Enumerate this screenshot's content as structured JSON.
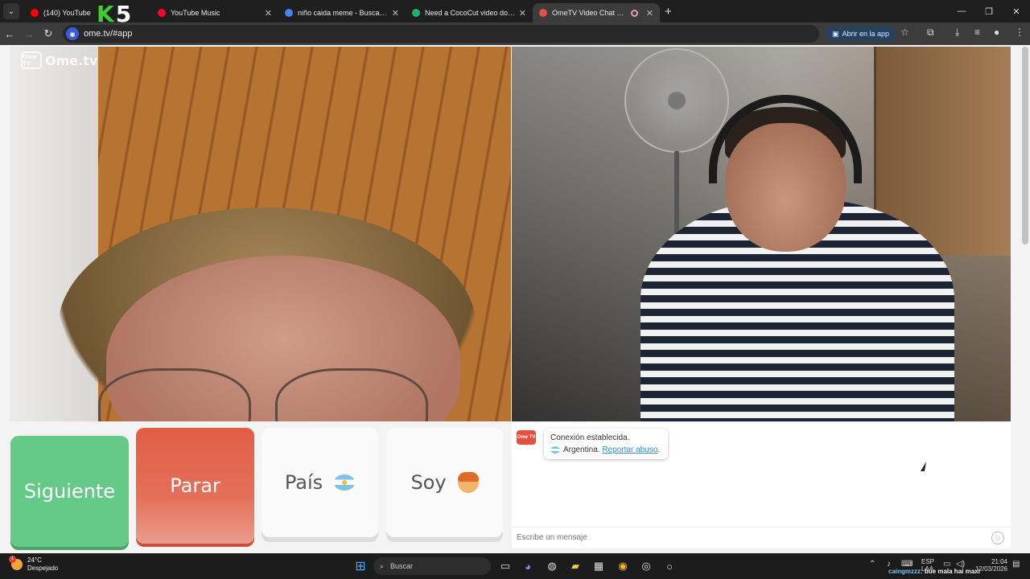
{
  "browser": {
    "tabs": [
      {
        "title": "(140) YouTube",
        "fav_color": "#ff0000",
        "active": false
      },
      {
        "title": "YouTube Music",
        "fav_color": "#ff0033",
        "active": false
      },
      {
        "title": "niño caida meme - Buscar con",
        "fav_color": "#4285f4",
        "active": false
      },
      {
        "title": "Need a CocoCut video downlo",
        "fav_color": "#1db36b",
        "active": false
      },
      {
        "title": "OmeTV Video Chat — Ome",
        "fav_color": "#e44f3f",
        "active": true
      }
    ],
    "overlay_logo": {
      "k": "K",
      "n": "5"
    },
    "url": "ome.tv/#app",
    "open_app_label": "Abrir en la app"
  },
  "site": {
    "logo_text": "Ome.tv",
    "logo_box": "Ome TV",
    "buttons": {
      "next": "Siguiente",
      "stop": "Parar",
      "country": "País",
      "iam": "Soy"
    },
    "chat": {
      "logo": "Ome TV",
      "connected": "Conexión establecida.",
      "country": "Argentina.",
      "report": "Reportar abuso",
      "report_suffix": ".",
      "input_placeholder": "Escribe un mensaje"
    }
  },
  "taskbar": {
    "weather_temp": "24°C",
    "weather_desc": "Despejado",
    "weather_badge": "1",
    "search_label": "Buscar",
    "lang": "ESP",
    "lang_sub": "LAA",
    "time": "21:04",
    "date": "12/03/2026"
  },
  "stream_chat": {
    "user": "caingmzzz:",
    "message": "bue mala hai maxi"
  }
}
